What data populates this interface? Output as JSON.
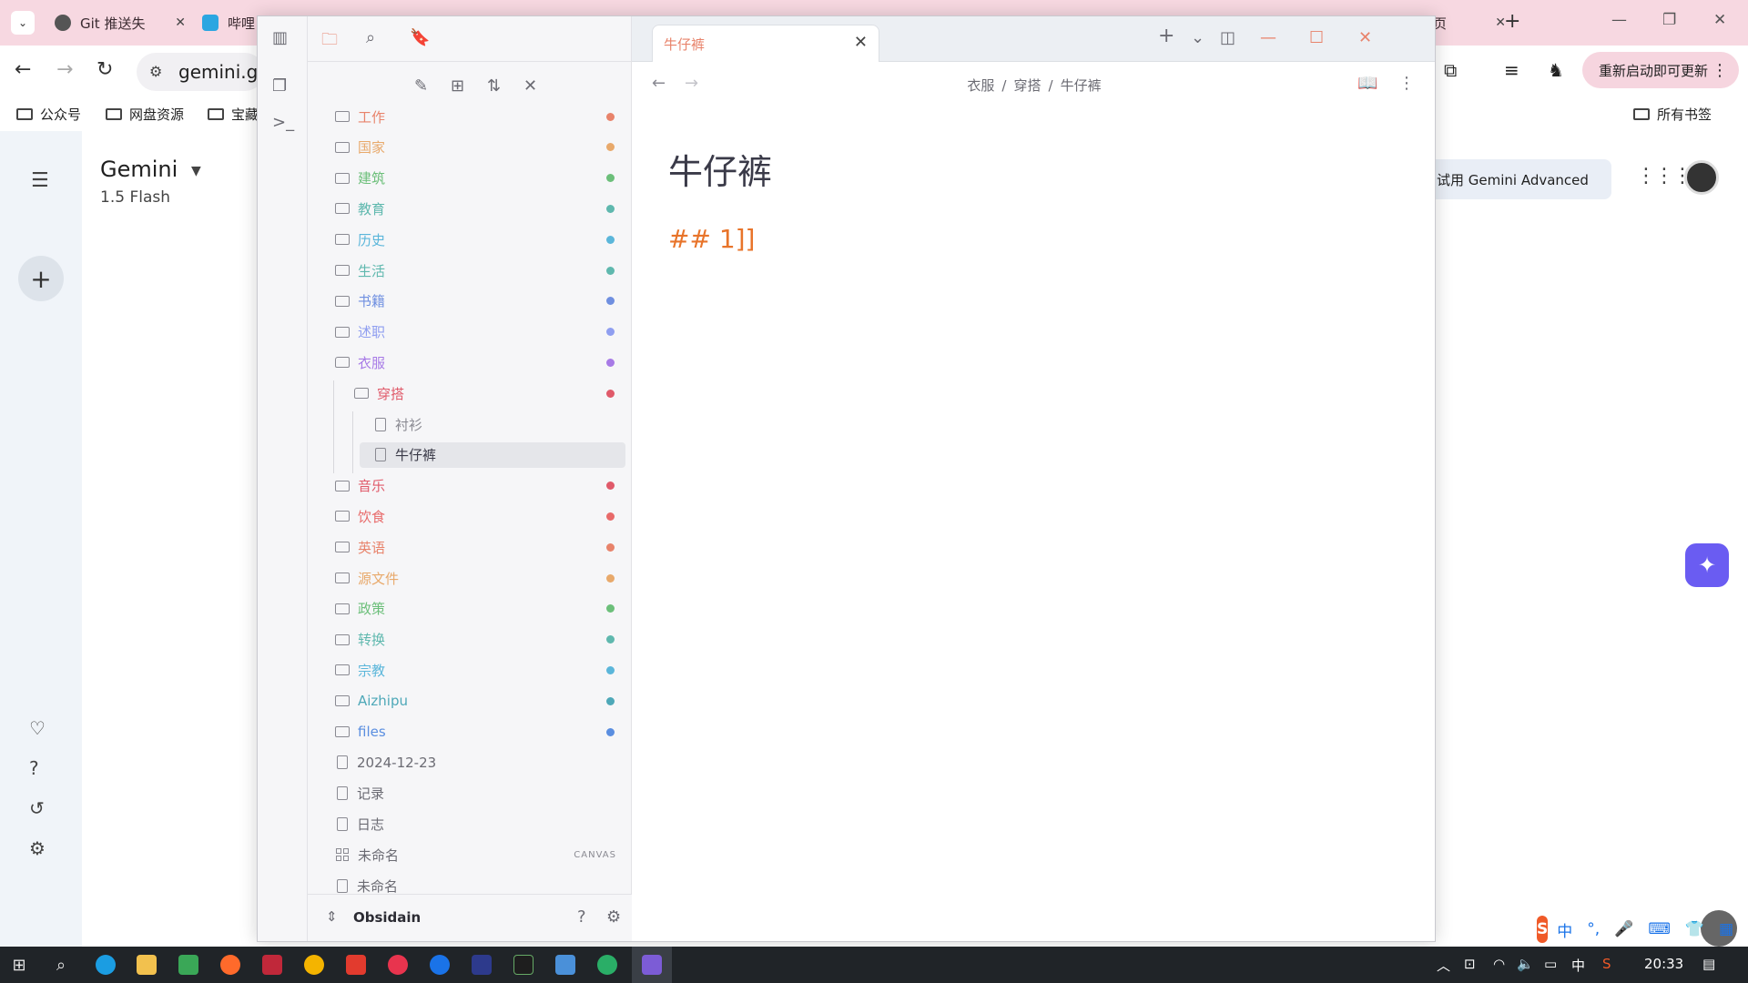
{
  "browser": {
    "tabs": [
      {
        "label": "Git 推送失",
        "color": "#555555"
      },
      {
        "label": "哔哩",
        "color": "#2ba6e1"
      }
    ],
    "right_tab_fragment": "页",
    "omnibox_text": "gemini.go",
    "update_button": "重新启动即可更新",
    "bookmarks": [
      "公众号",
      "网盘资源",
      "宝藏"
    ],
    "all_bookmarks": "所有书签"
  },
  "gemini": {
    "title": "Gemini",
    "model": "1.5 Flash",
    "advanced_button": "试用 Gemini Advanced"
  },
  "obsidian": {
    "vault_name": "Obsidain",
    "active_tab": "牛仔裤",
    "breadcrumb": [
      "衣服",
      "穿搭",
      "牛仔裤"
    ],
    "note_title": "牛仔裤",
    "note_body": "## 1]]",
    "canvas_badge": "CANVAS",
    "tree": [
      {
        "label": "工作",
        "kind": "folder",
        "color": "#e8836b",
        "depth": 0
      },
      {
        "label": "国家",
        "kind": "folder",
        "color": "#e8a96b",
        "depth": 0
      },
      {
        "label": "建筑",
        "kind": "folder",
        "color": "#6cbf7a",
        "depth": 0
      },
      {
        "label": "教育",
        "kind": "folder",
        "color": "#5fb8ae",
        "depth": 0
      },
      {
        "label": "历史",
        "kind": "folder",
        "color": "#5bb6da",
        "depth": 0
      },
      {
        "label": "生活",
        "kind": "folder",
        "color": "#5fb8ae",
        "depth": 0
      },
      {
        "label": "书籍",
        "kind": "folder",
        "color": "#6f8fe0",
        "depth": 0
      },
      {
        "label": "述职",
        "kind": "folder",
        "color": "#8f9ef0",
        "depth": 0
      },
      {
        "label": "衣服",
        "kind": "folder-open",
        "color": "#a77ae6",
        "depth": 0
      },
      {
        "label": "穿搭",
        "kind": "folder-open",
        "color": "#e05a6a",
        "depth": 1
      },
      {
        "label": "衬衫",
        "kind": "file",
        "color": "#8a8a92",
        "depth": 2
      },
      {
        "label": "牛仔裤",
        "kind": "file",
        "color": "#3a3a48",
        "depth": 2,
        "selected": true
      },
      {
        "label": "音乐",
        "kind": "folder",
        "color": "#e05a6a",
        "depth": 0
      },
      {
        "label": "饮食",
        "kind": "folder",
        "color": "#e86a6a",
        "depth": 0
      },
      {
        "label": "英语",
        "kind": "folder",
        "color": "#e8836b",
        "depth": 0
      },
      {
        "label": "源文件",
        "kind": "folder",
        "color": "#e8a96b",
        "depth": 0
      },
      {
        "label": "政策",
        "kind": "folder",
        "color": "#6cbf7a",
        "depth": 0
      },
      {
        "label": "转换",
        "kind": "folder",
        "color": "#5fb8ae",
        "depth": 0
      },
      {
        "label": "宗教",
        "kind": "folder",
        "color": "#5bb6da",
        "depth": 0
      },
      {
        "label": "Aizhipu",
        "kind": "folder",
        "color": "#4ea8b8",
        "depth": 0
      },
      {
        "label": "files",
        "kind": "folder",
        "color": "#5a8ee0",
        "depth": 0
      },
      {
        "label": "2024-12-23",
        "kind": "file",
        "color": "#6b6b73",
        "depth": 0
      },
      {
        "label": "记录",
        "kind": "file",
        "color": "#6b6b73",
        "depth": 0
      },
      {
        "label": "日志",
        "kind": "file",
        "color": "#6b6b73",
        "depth": 0
      },
      {
        "label": "未命名",
        "kind": "canvas",
        "color": "#6b6b73",
        "depth": 0
      },
      {
        "label": "未命名",
        "kind": "file",
        "color": "#6b6b73",
        "depth": 0
      }
    ]
  },
  "taskbar": {
    "clock": "20:33",
    "ime_lang": "中"
  },
  "ime": {
    "logo": "S",
    "mode": "中",
    "punct": "°,"
  }
}
